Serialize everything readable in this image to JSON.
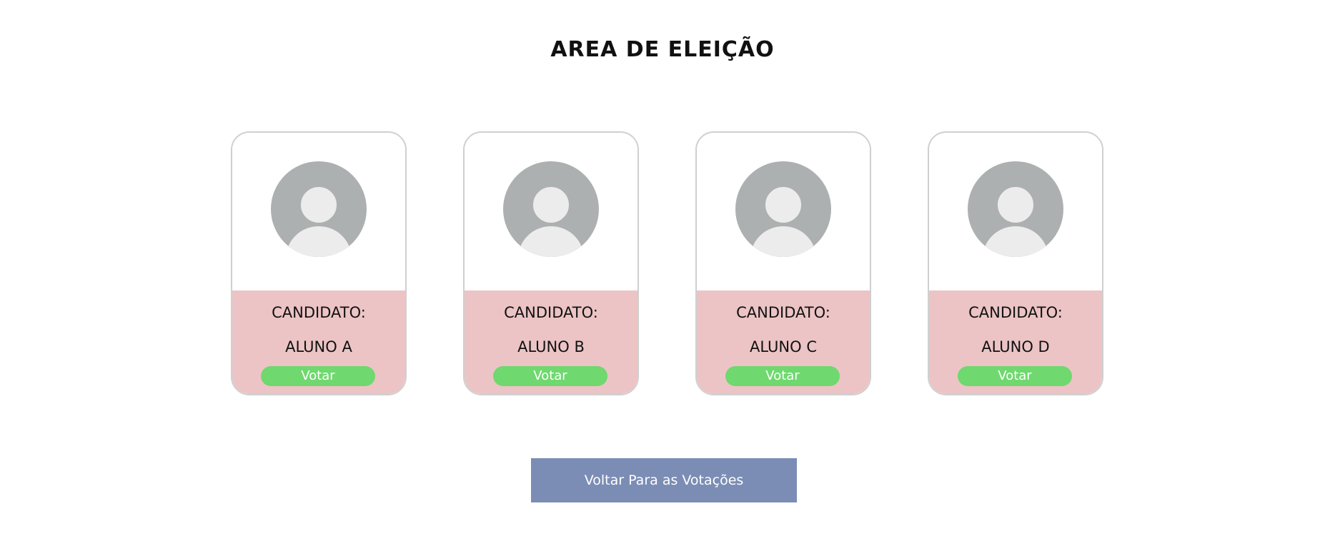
{
  "page": {
    "title": "AREA DE ELEIÇÃO"
  },
  "candidates": [
    {
      "label": "CANDIDATO:",
      "name": "ALUNO A",
      "vote_label": "Votar"
    },
    {
      "label": "CANDIDATO:",
      "name": "ALUNO B",
      "vote_label": "Votar"
    },
    {
      "label": "CANDIDATO:",
      "name": "ALUNO C",
      "vote_label": "Votar"
    },
    {
      "label": "CANDIDATO:",
      "name": "ALUNO D",
      "vote_label": "Votar"
    }
  ],
  "footer": {
    "back_label": "Voltar Para as Votações"
  },
  "colors": {
    "card_bottom": "#ecc4c5",
    "vote_button": "#6fd86e",
    "back_button": "#7b8db4",
    "avatar_bg": "#adb0b1",
    "avatar_figure": "#ececec"
  },
  "icons": {
    "avatar": "user-avatar-icon"
  }
}
